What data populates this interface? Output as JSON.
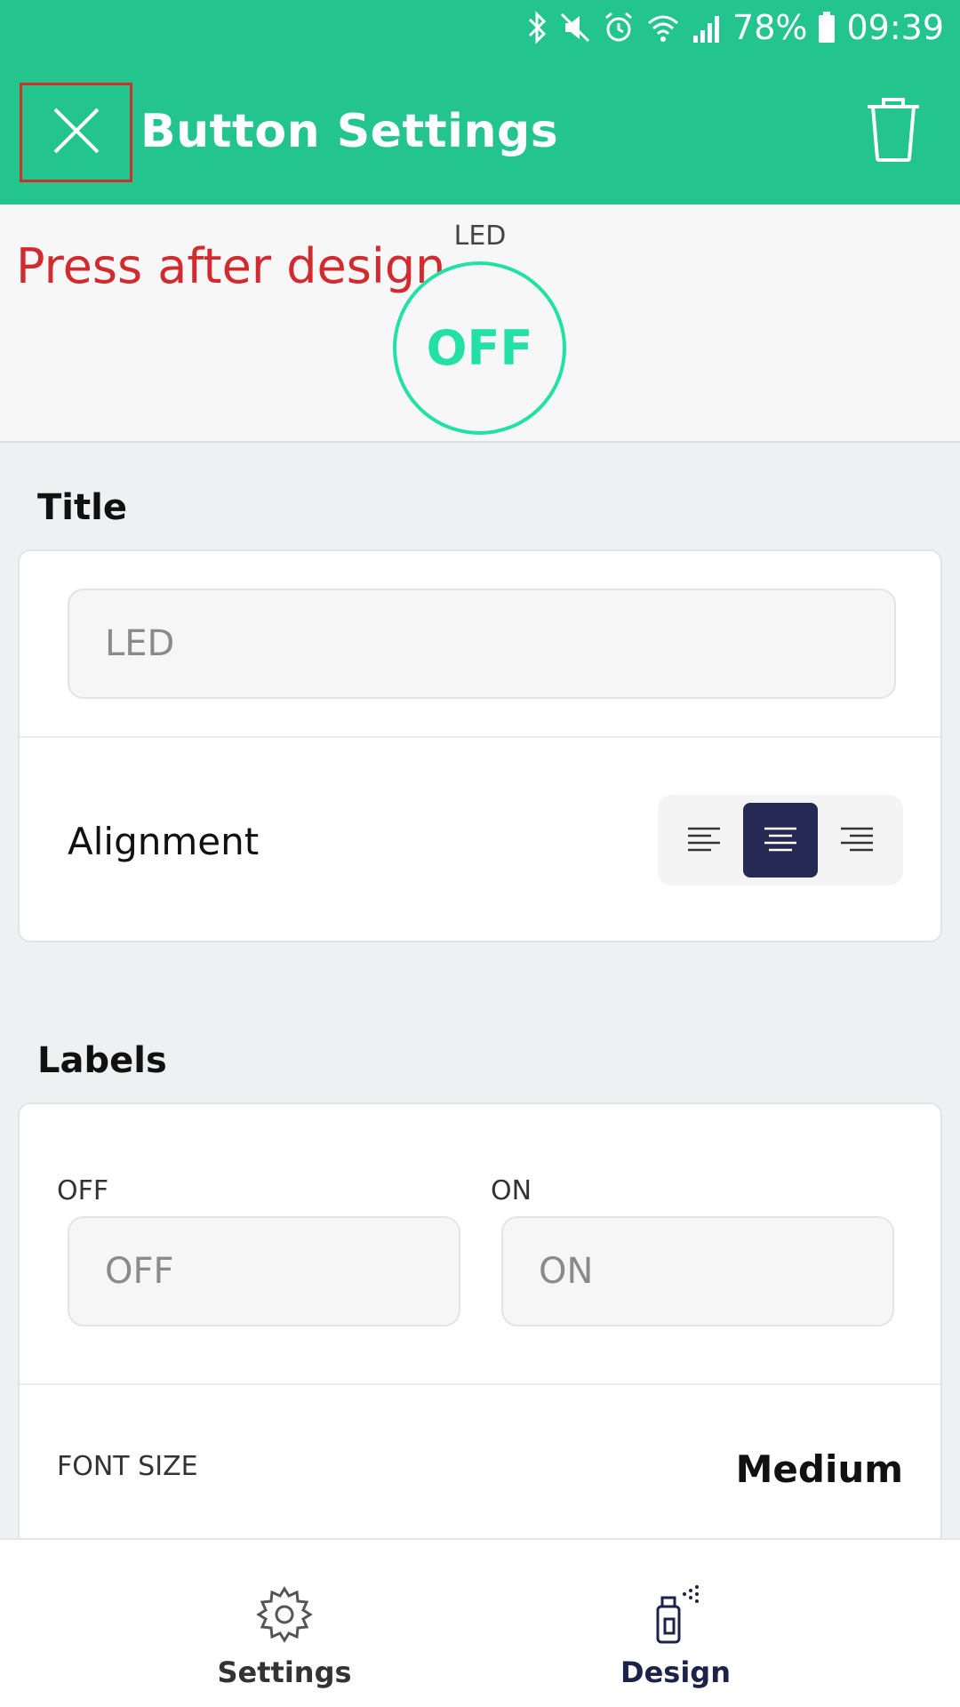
{
  "status_bar": {
    "battery_percent": "78%",
    "time": "09:39",
    "icons": [
      "bluetooth-icon",
      "mute-icon",
      "alarm-icon",
      "wifi-icon",
      "signal-icon",
      "battery-icon"
    ]
  },
  "header": {
    "title": "Button Settings",
    "close_icon": "close-icon",
    "trash_icon": "trash-icon",
    "background": "#23c48e"
  },
  "annotation": {
    "text": "Press after design",
    "color": "#d12a2f"
  },
  "preview": {
    "title": "LED",
    "button_label": "OFF",
    "accent": "#23e0a6"
  },
  "title_section": {
    "heading": "Title",
    "input_value": "LED",
    "alignment_label": "Alignment",
    "alignment_options": [
      "left",
      "center",
      "right"
    ],
    "alignment_selected": "center"
  },
  "labels_section": {
    "heading": "Labels",
    "off_caption": "OFF",
    "off_value": "OFF",
    "on_caption": "ON",
    "on_value": "ON",
    "font_size_label": "FONT SIZE",
    "font_size_value": "Medium"
  },
  "bottom_nav": {
    "items": [
      {
        "label": "Settings",
        "icon": "gear-icon",
        "active": false
      },
      {
        "label": "Design",
        "icon": "spray-can-icon",
        "active": true
      }
    ]
  }
}
